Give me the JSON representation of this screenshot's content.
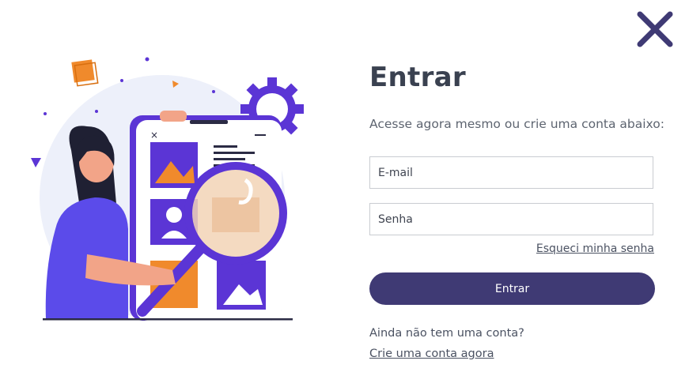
{
  "title": "Entrar",
  "subtitle": "Acesse agora mesmo ou crie uma conta abaixo:",
  "email_placeholder": "E-mail",
  "password_placeholder": "Senha",
  "forgot_label": "Esqueci minha senha",
  "submit_label": "Entrar",
  "no_account_text": "Ainda não tem uma conta?",
  "create_account_label": "Crie uma conta agora",
  "colors": {
    "primary": "#3f3a74",
    "text": "#3a4150",
    "close": "#3f3a74",
    "accent_orange": "#f08a2c",
    "accent_purple": "#5b35d5"
  },
  "icons": {
    "close": "close-icon",
    "illustration": "login-illustration"
  }
}
